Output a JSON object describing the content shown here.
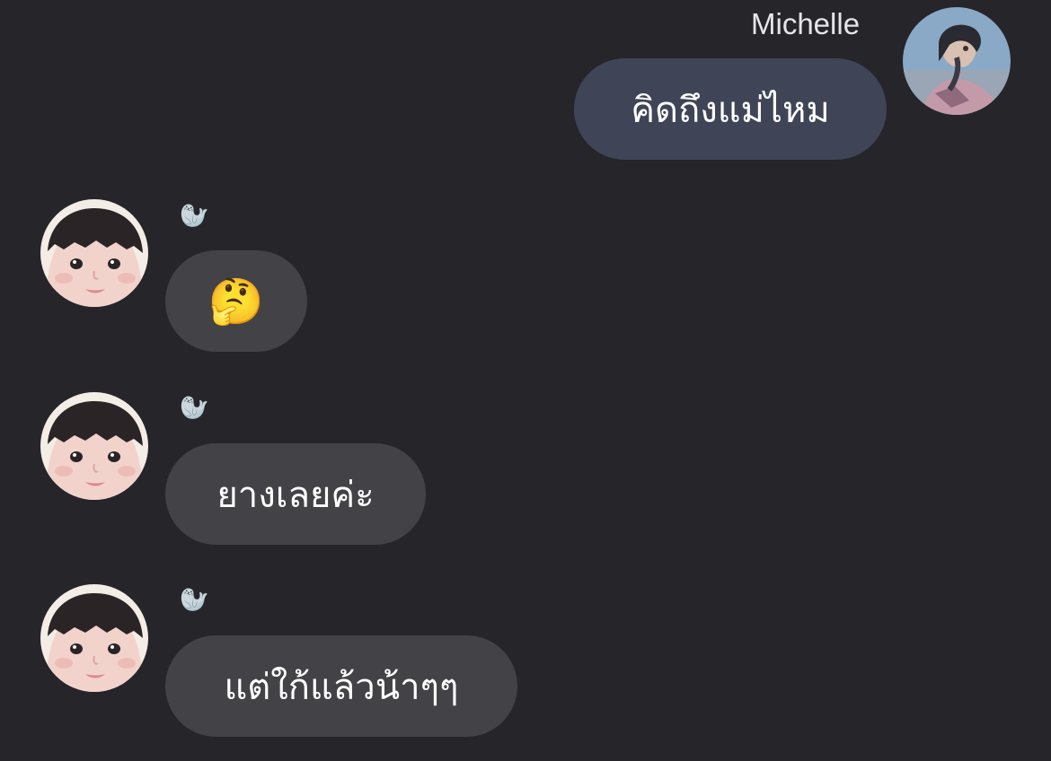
{
  "conversation": {
    "outgoing": {
      "sender_name": "Michelle",
      "text": "คิดถึงแม่ไหม"
    },
    "incoming": [
      {
        "nickname": "🦭",
        "text": "🤔"
      },
      {
        "nickname": "🦭",
        "text": "ยางเลยค่ะ"
      },
      {
        "nickname": "🦭",
        "text": "แต่ใก้แล้วน้าๆๆ"
      }
    ]
  },
  "colors": {
    "background": "#25252a",
    "outgoing_bubble": "#3f4556",
    "incoming_bubble": "#434347",
    "text": "#ffffff"
  }
}
